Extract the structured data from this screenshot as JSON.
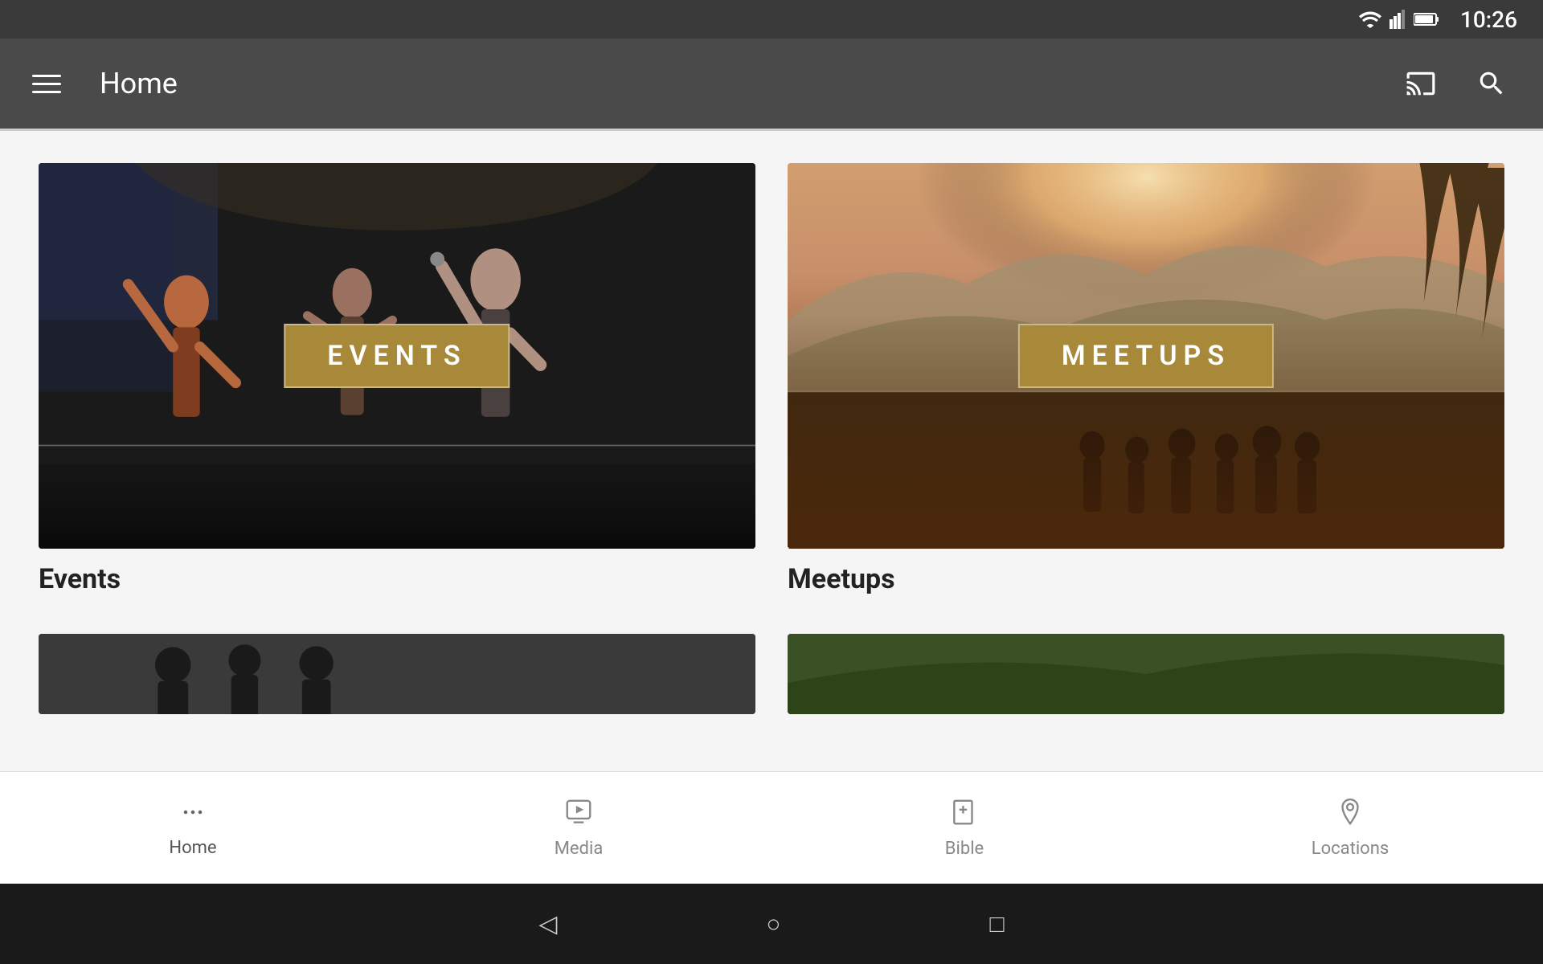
{
  "statusBar": {
    "time": "10:26"
  },
  "appBar": {
    "title": "Home",
    "castIconName": "cast-icon",
    "searchIconName": "search-icon"
  },
  "cards": [
    {
      "id": "events",
      "overlayLabel": "EVENTS",
      "title": "Events"
    },
    {
      "id": "meetups",
      "overlayLabel": "MEETUPS",
      "title": "Meetups"
    }
  ],
  "bottomNav": {
    "items": [
      {
        "id": "home",
        "label": "Home",
        "iconType": "dots",
        "active": true
      },
      {
        "id": "media",
        "label": "Media",
        "iconType": "play",
        "active": false
      },
      {
        "id": "bible",
        "label": "Bible",
        "iconType": "book",
        "active": false
      },
      {
        "id": "locations",
        "label": "Locations",
        "iconType": "pin",
        "active": false
      }
    ]
  },
  "androidNav": {
    "backLabel": "◁",
    "homeLabel": "○",
    "recentsLabel": "□"
  }
}
